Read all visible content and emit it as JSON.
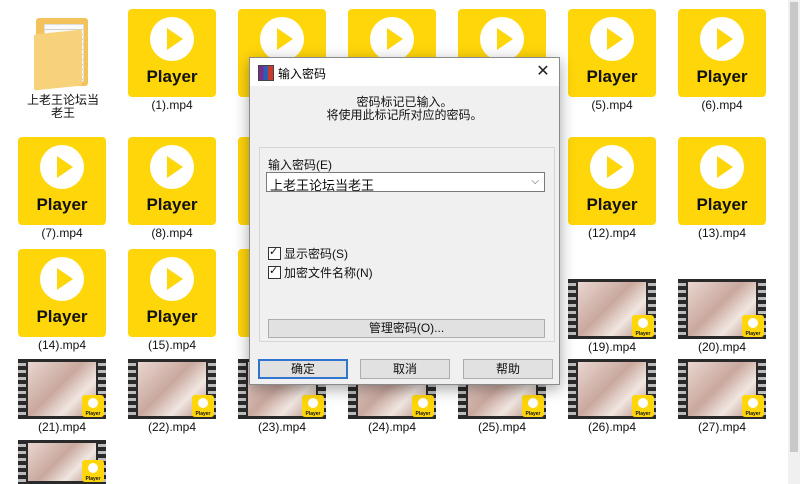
{
  "files": {
    "folder": {
      "label": "上老王论坛当老王",
      "icon": "folder-icon"
    },
    "player_text": "Player",
    "items": [
      "(1).mp4",
      "(5).mp4",
      "(6).mp4",
      "(7).mp4",
      "(8).mp4",
      "(12).mp4",
      "(13).mp4",
      "(14).mp4",
      "(15).mp4",
      "(19).mp4",
      "(20).mp4",
      "(21).mp4",
      "(22).mp4",
      "(23).mp4",
      "(24).mp4",
      "(25).mp4",
      "(26).mp4",
      "(27).mp4"
    ]
  },
  "dialog": {
    "title": "输入密码",
    "info_line1": "密码标记已输入。",
    "info_line2": "将使用此标记所对应的密码。",
    "field_label": "输入密码(E)",
    "field_value": "上老王论坛当老王",
    "show_password": "显示密码(S)",
    "encrypt_names": "加密文件名称(N)",
    "manage_button": "管理密码(O)...",
    "ok_button": "确定",
    "cancel_button": "取消",
    "help_button": "帮助",
    "close_icon": "close-icon",
    "app_icon": "winrar-icon"
  },
  "colors": {
    "player_yellow": "#FFD60A",
    "dialog_bg": "#f0f0f0",
    "focus_blue": "#2f75d0"
  }
}
